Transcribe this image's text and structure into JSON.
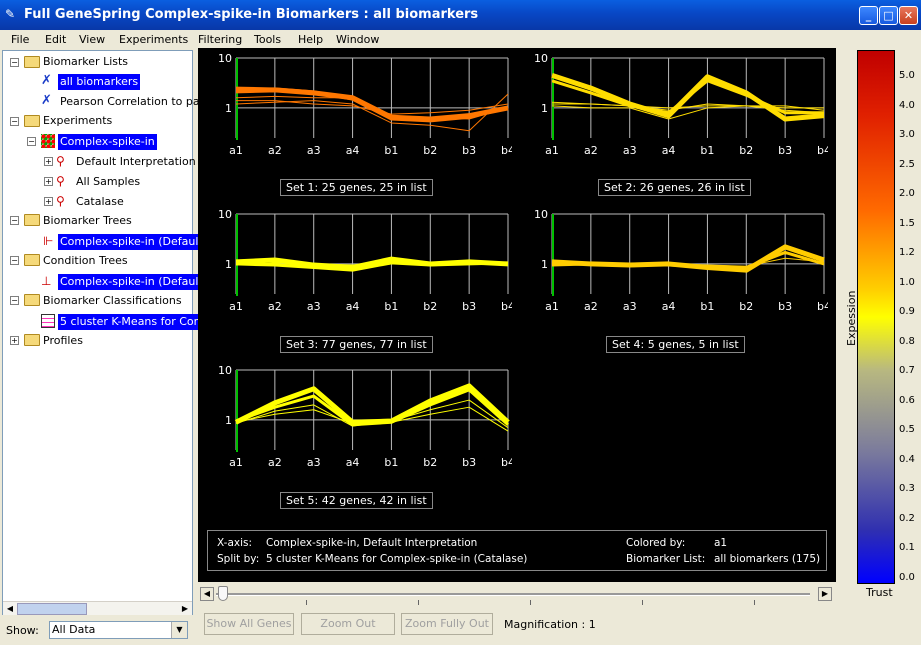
{
  "window": {
    "title": "Full GeneSpring Complex-spike-in Biomarkers : all biomarkers"
  },
  "menu": [
    "File",
    "Edit",
    "View",
    "Experiments",
    "Filtering",
    "Tools",
    "Help",
    "Window"
  ],
  "tree": {
    "biomarker_lists": "Biomarker Lists",
    "all_biomarkers": "all biomarkers",
    "pearson": "Pearson Correlation to pa",
    "experiments": "Experiments",
    "complex_spike_in": "Complex-spike-in",
    "default_interp": "Default Interpretation",
    "all_samples": "All Samples",
    "catalase": "Catalase",
    "biomarker_trees": "Biomarker Trees",
    "bt_item": "Complex-spike-in (Defaul",
    "condition_trees": "Condition Trees",
    "ct_item": "Complex-spike-in (Defaul",
    "biomarker_classifications": "Biomarker Classifications",
    "bc_item": "5 cluster K-Means for Com",
    "profiles": "Profiles"
  },
  "show": {
    "label": "Show:",
    "value": "All Data"
  },
  "chart_data": [
    {
      "type": "line",
      "title": "Set 1: 25 genes, 25 in list",
      "categories": [
        "a1",
        "a2",
        "a3",
        "a4",
        "b1",
        "b2",
        "b3",
        "b4"
      ],
      "yscale": "log",
      "yticks": [
        "10",
        "1"
      ],
      "series_color": "#ff7700",
      "series": [
        {
          "values": [
            2.2,
            2.3,
            2.0,
            1.6,
            0.65,
            0.6,
            0.7,
            1.0
          ]
        },
        {
          "values": [
            2.5,
            2.4,
            2.1,
            1.5,
            0.6,
            0.55,
            0.65,
            1.0
          ]
        },
        {
          "values": [
            1.6,
            1.7,
            1.6,
            1.6,
            0.7,
            0.65,
            0.6,
            1.0
          ]
        },
        {
          "values": [
            1.4,
            1.4,
            1.2,
            1.1,
            0.75,
            0.8,
            0.9,
            1.2
          ]
        },
        {
          "values": [
            1.2,
            1.3,
            1.4,
            1.2,
            0.5,
            0.45,
            0.35,
            1.9
          ]
        }
      ]
    },
    {
      "type": "line",
      "title": "Set 2: 26 genes, 26 in list",
      "categories": [
        "a1",
        "a2",
        "a3",
        "a4",
        "b1",
        "b2",
        "b3",
        "b4"
      ],
      "yscale": "log",
      "yticks": [
        "10",
        "1"
      ],
      "series_color": "#ffdd00",
      "series": [
        {
          "values": [
            4.5,
            2.5,
            1.2,
            0.7,
            4.2,
            2.0,
            0.6,
            0.7
          ]
        },
        {
          "values": [
            3.5,
            2.0,
            1.1,
            0.8,
            3.5,
            1.8,
            0.8,
            0.8
          ]
        },
        {
          "values": [
            1.2,
            1.2,
            1.1,
            1.0,
            1.1,
            1.1,
            1.0,
            1.0
          ]
        },
        {
          "values": [
            1.1,
            1.0,
            1.0,
            0.6,
            1.0,
            1.1,
            1.1,
            0.9
          ]
        },
        {
          "values": [
            1.3,
            1.2,
            1.1,
            0.9,
            1.2,
            1.1,
            0.9,
            0.8
          ]
        }
      ]
    },
    {
      "type": "line",
      "title": "Set 3: 77 genes, 77 in list",
      "categories": [
        "a1",
        "a2",
        "a3",
        "a4",
        "b1",
        "b2",
        "b3",
        "b4"
      ],
      "yscale": "log",
      "yticks": [
        "10",
        "1"
      ],
      "series_color": "#ffff00",
      "series": [
        {
          "values": [
            1.1,
            1.2,
            0.95,
            0.85,
            1.25,
            1.0,
            1.1,
            1.0
          ]
        },
        {
          "values": [
            1.0,
            0.95,
            0.85,
            0.75,
            1.05,
            0.95,
            1.0,
            1.05
          ]
        },
        {
          "values": [
            0.95,
            1.05,
            1.0,
            0.95,
            1.1,
            1.05,
            1.0,
            0.95
          ]
        },
        {
          "values": [
            1.05,
            1.0,
            0.9,
            0.8,
            1.0,
            1.0,
            1.05,
            1.0
          ]
        }
      ]
    },
    {
      "type": "line",
      "title": "Set 4: 5 genes, 5 in list",
      "categories": [
        "a1",
        "a2",
        "a3",
        "a4",
        "b1",
        "b2",
        "b3",
        "b4"
      ],
      "yscale": "log",
      "yticks": [
        "10",
        "1"
      ],
      "series_color": "#ffcc00",
      "series": [
        {
          "values": [
            1.1,
            1.0,
            0.95,
            1.0,
            0.85,
            0.75,
            2.2,
            1.2
          ]
        },
        {
          "values": [
            0.95,
            1.0,
            0.95,
            0.95,
            0.9,
            0.85,
            1.7,
            1.0
          ]
        },
        {
          "values": [
            1.0,
            1.05,
            1.0,
            1.0,
            0.95,
            0.9,
            1.3,
            1.1
          ]
        }
      ]
    },
    {
      "type": "line",
      "title": "Set 5: 42 genes, 42 in list",
      "categories": [
        "a1",
        "a2",
        "a3",
        "a4",
        "b1",
        "b2",
        "b3",
        "b4"
      ],
      "yscale": "log",
      "yticks": [
        "10",
        "1"
      ],
      "series_color": "#ffff00",
      "series": [
        {
          "values": [
            0.9,
            2.2,
            4.2,
            0.9,
            0.95,
            2.4,
            4.8,
            0.9
          ]
        },
        {
          "values": [
            0.95,
            1.8,
            3.0,
            0.8,
            0.9,
            2.0,
            4.0,
            0.8
          ]
        },
        {
          "values": [
            0.85,
            1.5,
            2.0,
            0.75,
            0.95,
            1.6,
            2.5,
            0.7
          ]
        },
        {
          "values": [
            0.9,
            1.3,
            1.6,
            0.85,
            0.9,
            1.3,
            1.8,
            0.6
          ]
        }
      ]
    }
  ],
  "info": {
    "xaxis_label": "X-axis:",
    "xaxis_value": "Complex-spike-in, Default Interpretation",
    "split_label": "Split by:",
    "split_value": "5 cluster K-Means for Complex-spike-in (Catalase)",
    "colored_label": "Colored by:",
    "colored_value": "a1",
    "list_label": "Biomarker List:",
    "list_value": "all biomarkers (175)"
  },
  "buttons": {
    "show_all": "Show All Genes",
    "zoom_out": "Zoom Out",
    "zoom_fully_out": "Zoom Fully Out",
    "magnification": "Magnification : 1"
  },
  "colorbar": {
    "ticks": [
      "5.0",
      "4.0",
      "3.0",
      "2.5",
      "2.0",
      "1.5",
      "1.2",
      "1.0",
      "0.9",
      "0.8",
      "0.7",
      "0.6",
      "0.5",
      "0.4",
      "0.3",
      "0.2",
      "0.1",
      "0.0"
    ],
    "ylabel": "Expession",
    "xlabel": "Trust"
  }
}
